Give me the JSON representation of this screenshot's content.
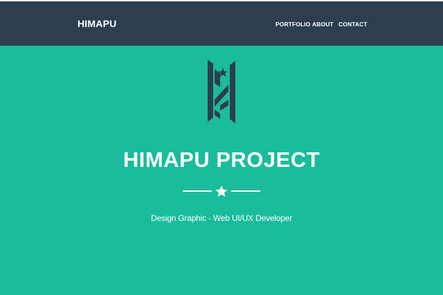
{
  "navbar": {
    "brand": "HIMAPU",
    "links": [
      {
        "label": "PORTFOLIO"
      },
      {
        "label": "ABOUT"
      },
      {
        "label": "CONTACT"
      }
    ]
  },
  "hero": {
    "logo_icon": "himapu-h-logo-icon",
    "title": "HIMAPU PROJECT",
    "divider_icon": "star-icon",
    "subtitle": "Design Graphic - Web UI/UX Developer"
  },
  "colors": {
    "navbar_bg": "#2c3e50",
    "hero_bg": "#1abc9c",
    "text": "#ffffff",
    "logo": "#2c3e50"
  }
}
